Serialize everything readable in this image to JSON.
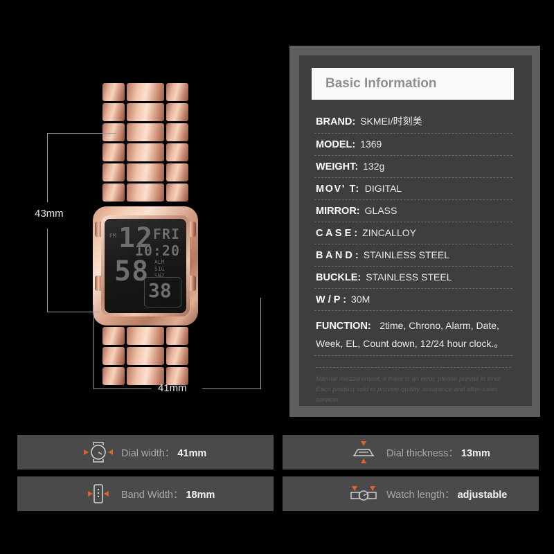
{
  "product": {
    "dimensions": {
      "height_label": "43mm",
      "width_label": "41mm"
    },
    "watch_display": {
      "meridiem": "PM",
      "hour": "12",
      "minute": "58",
      "weekday": "FRI",
      "secondary_time": "10:20",
      "indicator_alm": "ALM",
      "indicator_sig": "SIG",
      "indicator_snz": "SNZ",
      "boxed_value": "38"
    }
  },
  "spec_panel": {
    "header": "Basic Information",
    "rows": [
      {
        "label": "BRAND:",
        "value": "SKMEI/时刻美",
        "spacing": "ls1"
      },
      {
        "label": "MODEL:",
        "value": "1369",
        "spacing": "ls1"
      },
      {
        "label": "WEIGHT:",
        "value": "132g",
        "spacing": "ls1"
      },
      {
        "label": "MOV' T:",
        "value": "DIGITAL",
        "spacing": "ls3"
      },
      {
        "label": "MIRROR:",
        "value": "GLASS",
        "spacing": "ls1"
      },
      {
        "label": "C A S E :",
        "value": "ZINCALLOY",
        "spacing": "ls1"
      },
      {
        "label": "B A N D :",
        "value": "STAINLESS STEEL",
        "spacing": "ls1"
      },
      {
        "label": "BUCKLE:",
        "value": "STAINLESS STEEL",
        "spacing": "ls1"
      },
      {
        "label": "W / P :",
        "value": "30M",
        "spacing": "ls1"
      }
    ],
    "function": {
      "label": "FUNCTION:",
      "line1": "2time, Chrono, Alarm, Date,",
      "line2": "Week, EL, Count down, 12/24 hour clock.。"
    },
    "disclaimer": {
      "line1": "Manual measurement, if there is an error, please prevail in kind!",
      "line2": "Each product sold to provide quality assurance and after-sales service!"
    }
  },
  "feature_bars": [
    {
      "icon": "watch-dial-width-icon",
      "label": "Dial width：",
      "value": "41mm"
    },
    {
      "icon": "watch-thickness-icon",
      "label": "Dial thickness：",
      "value": "13mm"
    },
    {
      "icon": "watch-band-width-icon",
      "label": "Band Width：",
      "value": "18mm"
    },
    {
      "icon": "watch-length-icon",
      "label": "Watch length：",
      "value": "adjustable"
    }
  ],
  "colors": {
    "background": "#000000",
    "panel_frame": "#5e5e5e",
    "panel_fill": "#3e3e3e",
    "bar_fill": "#4a4a4a",
    "accent_orange": "#e2622a",
    "header_fill": "#fafafa"
  }
}
